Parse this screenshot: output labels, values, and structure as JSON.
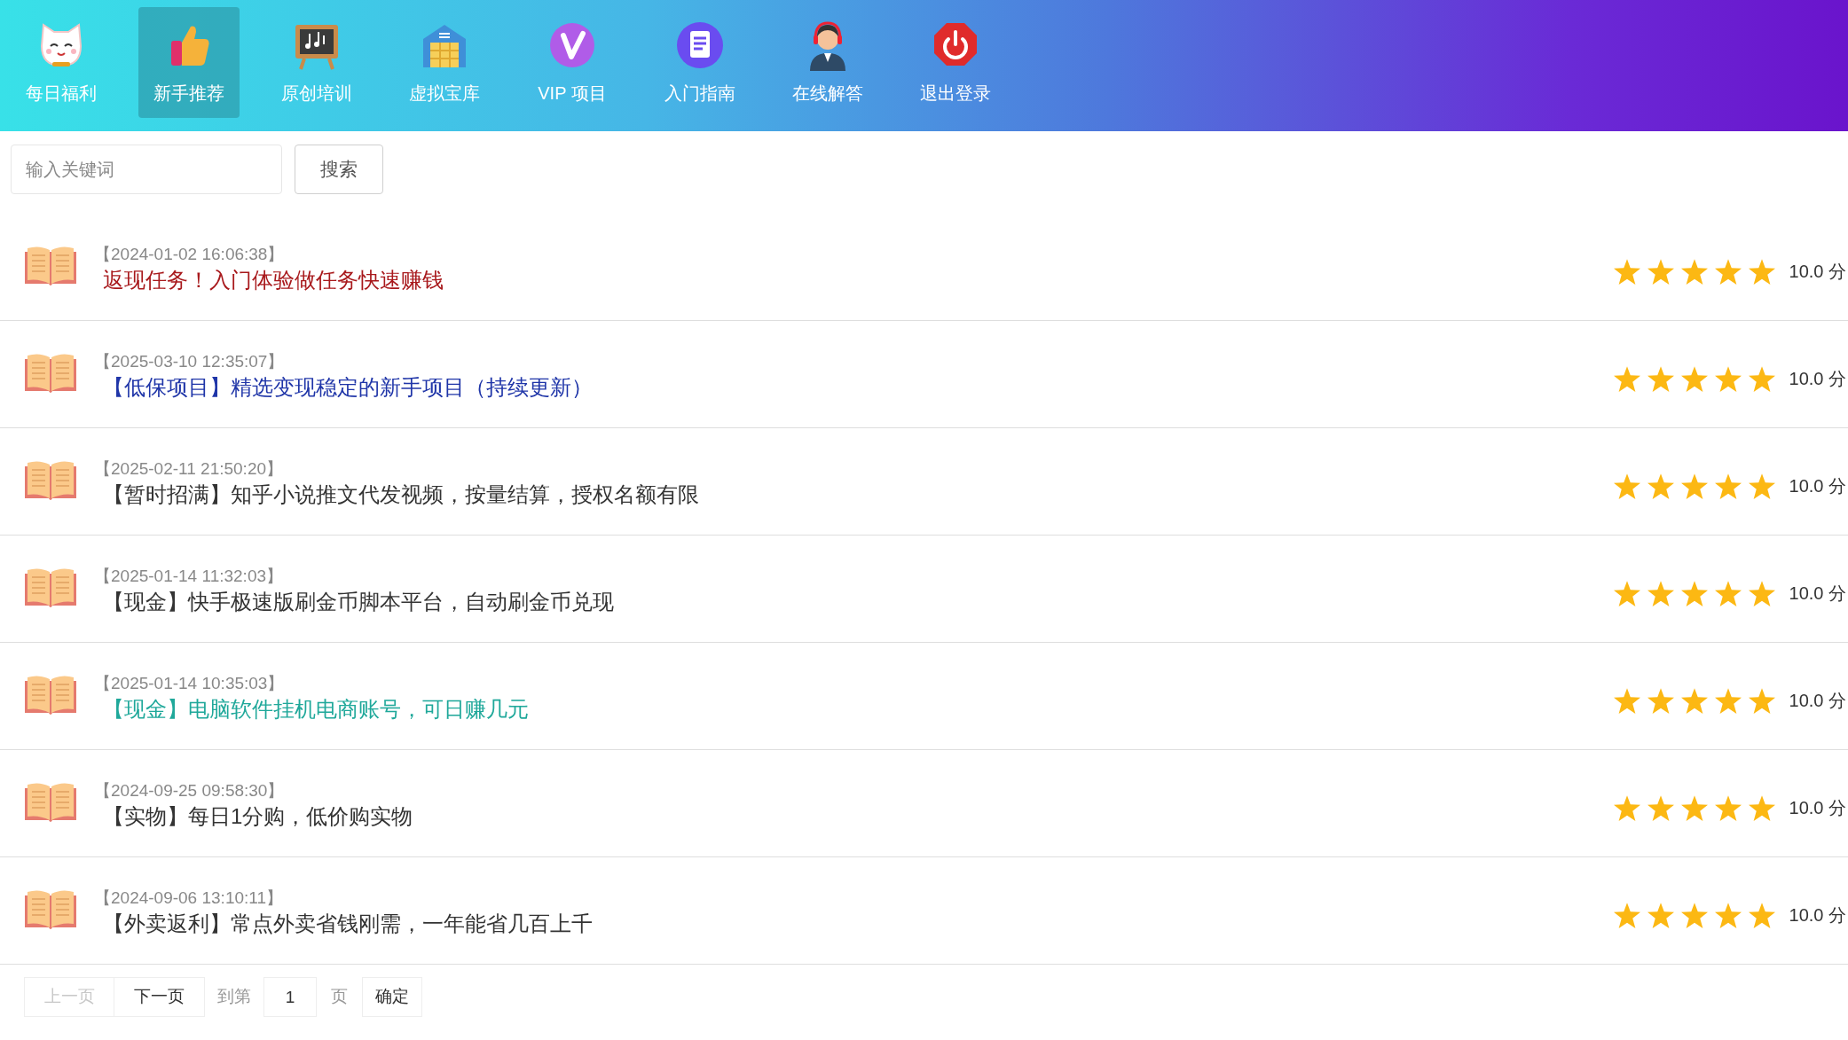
{
  "nav": [
    {
      "label": "每日福利",
      "selected": false
    },
    {
      "label": "新手推荐",
      "selected": true
    },
    {
      "label": "原创培训",
      "selected": false
    },
    {
      "label": "虚拟宝库",
      "selected": false
    },
    {
      "label": "VIP 项目",
      "selected": false
    },
    {
      "label": "入门指南",
      "selected": false
    },
    {
      "label": "在线解答",
      "selected": false
    },
    {
      "label": "退出登录",
      "selected": false
    }
  ],
  "search": {
    "placeholder": "输入关键词",
    "button": "搜索"
  },
  "articles": [
    {
      "date": "【2024-01-02 16:06:38】",
      "title": "返现任务！入门体验做任务快速赚钱",
      "color": "#a8191c",
      "stars": 5,
      "score": "10.0 分"
    },
    {
      "date": "【2025-03-10 12:35:07】",
      "title": "【低保项目】精选变现稳定的新手项目（持续更新）",
      "color": "#1f35a8",
      "stars": 5,
      "score": "10.0 分"
    },
    {
      "date": "【2025-02-11 21:50:20】",
      "title": "【暂时招满】知乎小说推文代发视频，按量结算，授权名额有限",
      "color": "#333333",
      "stars": 5,
      "score": "10.0 分"
    },
    {
      "date": "【2025-01-14 11:32:03】",
      "title": "【现金】快手极速版刷金币脚本平台，自动刷金币兑现",
      "color": "#333333",
      "stars": 5,
      "score": "10.0 分"
    },
    {
      "date": "【2025-01-14 10:35:03】",
      "title": "【现金】电脑软件挂机电商账号，可日赚几元",
      "color": "#1fa89a",
      "stars": 5,
      "score": "10.0 分"
    },
    {
      "date": "【2024-09-25 09:58:30】",
      "title": "【实物】每日1分购，低价购实物",
      "color": "#333333",
      "stars": 5,
      "score": "10.0 分"
    },
    {
      "date": "【2024-09-06 13:10:11】",
      "title": "【外卖返利】常点外卖省钱刚需，一年能省几百上千",
      "color": "#333333",
      "stars": 5,
      "score": "10.0 分"
    }
  ],
  "pagination": {
    "prev": {
      "label": "上一页",
      "disabled": true
    },
    "next": {
      "label": "下一页",
      "disabled": false
    },
    "goto_label": "到第",
    "page": "1",
    "page_suffix": "页",
    "confirm": "确定"
  }
}
